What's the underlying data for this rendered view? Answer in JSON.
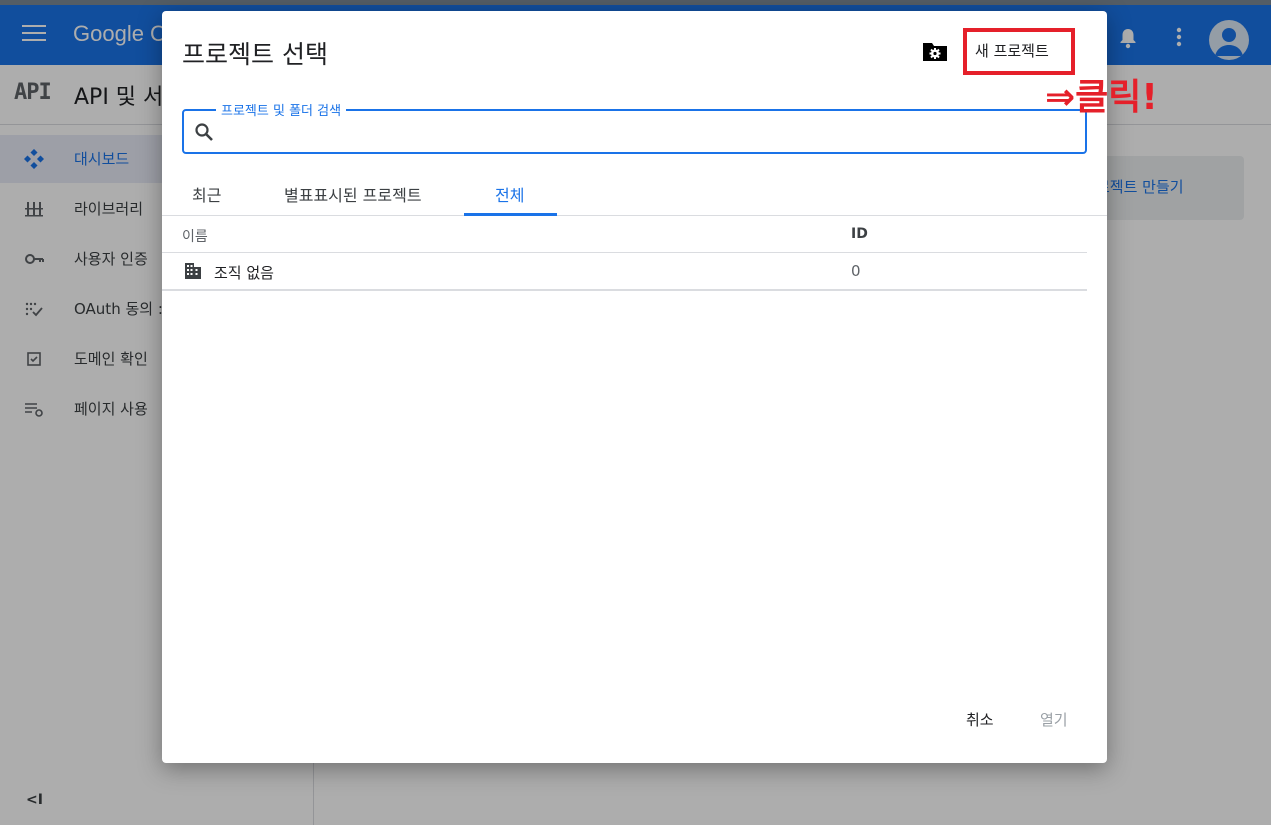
{
  "console": {
    "brand": "Google C",
    "api_logo": "API",
    "api_title": "API 및 서",
    "sidebar": [
      {
        "label": "대시보드",
        "icon": "dashboard-icon",
        "active": true
      },
      {
        "label": "라이브러리",
        "icon": "library-icon",
        "active": false
      },
      {
        "label": "사용자 인증",
        "icon": "key-icon",
        "active": false
      },
      {
        "label": "OAuth 동의 :",
        "icon": "oauth-consent-icon",
        "active": false
      },
      {
        "label": "도메인 확인",
        "icon": "domain-check-icon",
        "active": false
      },
      {
        "label": "페이지 사용",
        "icon": "page-settings-icon",
        "active": false
      }
    ],
    "collapse_label": "<I",
    "create_project_label": "로젝트 만들기"
  },
  "dialog": {
    "title": "프로젝트 선택",
    "new_project_label": "새 프로젝트",
    "search": {
      "label": "프로젝트 및 폴더 검색",
      "value": "",
      "placeholder": ""
    },
    "tabs": [
      {
        "label": "최근",
        "active": false
      },
      {
        "label": "별표표시된 프로젝트",
        "active": false
      },
      {
        "label": "전체",
        "active": true
      }
    ],
    "table": {
      "columns": [
        "이름",
        "ID"
      ],
      "rows": [
        {
          "name": "조직 없음",
          "id": "0",
          "icon": "building-icon"
        }
      ]
    },
    "cancel_label": "취소",
    "open_label": "열기"
  },
  "annotation": {
    "text": "⇒클릭!",
    "color": "#e5202a"
  },
  "colors": {
    "primary": "#1a73e8",
    "annotation": "#e5202a",
    "scrim": "rgba(0,0,0,0.32)"
  }
}
